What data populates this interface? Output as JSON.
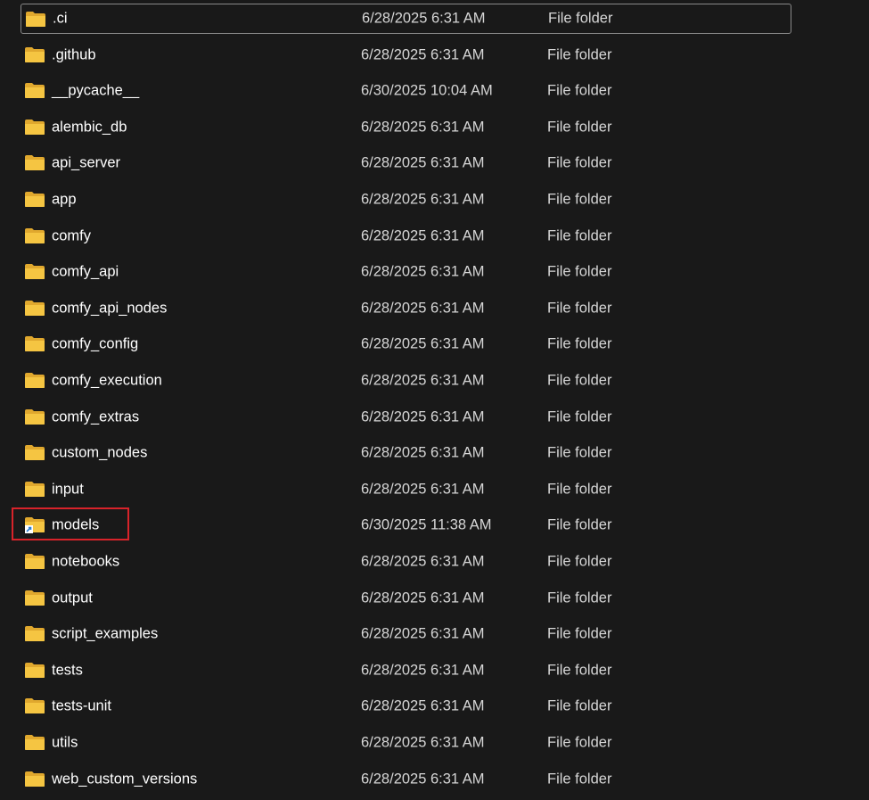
{
  "files": [
    {
      "name": ".ci",
      "date": "6/28/2025 6:31 AM",
      "type": "File folder",
      "icon": "folder-icon",
      "selected": true
    },
    {
      "name": ".github",
      "date": "6/28/2025 6:31 AM",
      "type": "File folder",
      "icon": "folder-icon"
    },
    {
      "name": "__pycache__",
      "date": "6/30/2025 10:04 AM",
      "type": "File folder",
      "icon": "folder-icon"
    },
    {
      "name": "alembic_db",
      "date": "6/28/2025 6:31 AM",
      "type": "File folder",
      "icon": "folder-icon"
    },
    {
      "name": "api_server",
      "date": "6/28/2025 6:31 AM",
      "type": "File folder",
      "icon": "folder-icon"
    },
    {
      "name": "app",
      "date": "6/28/2025 6:31 AM",
      "type": "File folder",
      "icon": "folder-icon"
    },
    {
      "name": "comfy",
      "date": "6/28/2025 6:31 AM",
      "type": "File folder",
      "icon": "folder-icon"
    },
    {
      "name": "comfy_api",
      "date": "6/28/2025 6:31 AM",
      "type": "File folder",
      "icon": "folder-icon"
    },
    {
      "name": "comfy_api_nodes",
      "date": "6/28/2025 6:31 AM",
      "type": "File folder",
      "icon": "folder-icon"
    },
    {
      "name": "comfy_config",
      "date": "6/28/2025 6:31 AM",
      "type": "File folder",
      "icon": "folder-icon"
    },
    {
      "name": "comfy_execution",
      "date": "6/28/2025 6:31 AM",
      "type": "File folder",
      "icon": "folder-icon"
    },
    {
      "name": "comfy_extras",
      "date": "6/28/2025 6:31 AM",
      "type": "File folder",
      "icon": "folder-icon"
    },
    {
      "name": "custom_nodes",
      "date": "6/28/2025 6:31 AM",
      "type": "File folder",
      "icon": "folder-icon"
    },
    {
      "name": "input",
      "date": "6/28/2025 6:31 AM",
      "type": "File folder",
      "icon": "folder-icon"
    },
    {
      "name": "models",
      "date": "6/30/2025 11:38 AM",
      "type": "File folder",
      "icon": "folder-shortcut-icon",
      "highlighted": true
    },
    {
      "name": "notebooks",
      "date": "6/28/2025 6:31 AM",
      "type": "File folder",
      "icon": "folder-icon"
    },
    {
      "name": "output",
      "date": "6/28/2025 6:31 AM",
      "type": "File folder",
      "icon": "folder-icon"
    },
    {
      "name": "script_examples",
      "date": "6/28/2025 6:31 AM",
      "type": "File folder",
      "icon": "folder-icon"
    },
    {
      "name": "tests",
      "date": "6/28/2025 6:31 AM",
      "type": "File folder",
      "icon": "folder-icon"
    },
    {
      "name": "tests-unit",
      "date": "6/28/2025 6:31 AM",
      "type": "File folder",
      "icon": "folder-icon"
    },
    {
      "name": "utils",
      "date": "6/28/2025 6:31 AM",
      "type": "File folder",
      "icon": "folder-icon"
    },
    {
      "name": "web_custom_versions",
      "date": "6/28/2025 6:31 AM",
      "type": "File folder",
      "icon": "folder-icon"
    }
  ],
  "colors": {
    "background": "#191919",
    "folder": "#f5c542",
    "highlight": "#d8232a",
    "shortcut_arrow": "#2a7fd4"
  }
}
